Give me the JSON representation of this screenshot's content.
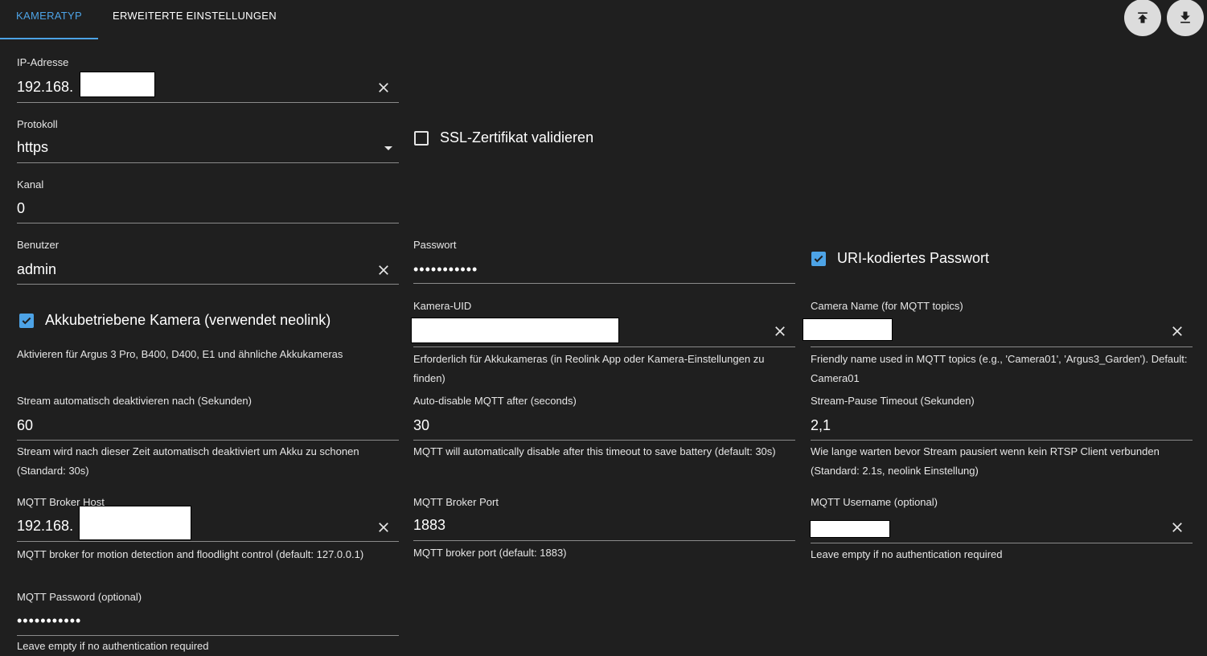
{
  "tabs": [
    {
      "label": "KAMERATYP",
      "active": true
    },
    {
      "label": "ERWEITERTE EINSTELLUNGEN",
      "active": false
    }
  ],
  "toolbar": {
    "upload_icon": "upload-icon",
    "download_icon": "download-icon"
  },
  "fields": {
    "ip": {
      "label": "IP-Adresse",
      "value": "192.168."
    },
    "protocol": {
      "label": "Protokoll",
      "value": "https"
    },
    "channel": {
      "label": "Kanal",
      "value": "0"
    },
    "user": {
      "label": "Benutzer",
      "value": "admin"
    },
    "password": {
      "label": "Passwort",
      "value": "•••••••••••"
    },
    "camera_uid": {
      "label": "Kamera-UID",
      "value": "",
      "helper": "Erforderlich für Akkukameras (in Reolink App oder Kamera-Einstellungen zu finden)"
    },
    "camera_name": {
      "label": "Camera Name (for MQTT topics)",
      "value": "",
      "helper": "Friendly name used in MQTT topics (e.g., 'Camera01', 'Argus3_Garden'). Default: Camera01"
    },
    "stream_disable": {
      "label": "Stream automatisch deaktivieren nach (Sekunden)",
      "value": "60",
      "helper": "Stream wird nach dieser Zeit automatisch deaktiviert um Akku zu schonen (Standard: 30s)"
    },
    "mqtt_disable": {
      "label": "Auto-disable MQTT after (seconds)",
      "value": "30",
      "helper": "MQTT will automatically disable after this timeout to save battery (default: 30s)"
    },
    "stream_pause": {
      "label": "Stream-Pause Timeout (Sekunden)",
      "value": "2,1",
      "helper": "Wie lange warten bevor Stream pausiert wenn kein RTSP Client verbunden (Standard: 2.1s, neolink Einstellung)"
    },
    "mqtt_host": {
      "label": "MQTT Broker Host",
      "value": "192.168.",
      "helper": "MQTT broker for motion detection and floodlight control (default: 127.0.0.1)"
    },
    "mqtt_port": {
      "label": "MQTT Broker Port",
      "value": "1883",
      "helper": "MQTT broker port (default: 1883)"
    },
    "mqtt_user": {
      "label": "MQTT Username (optional)",
      "value": "",
      "helper": "Leave empty if no authentication required"
    },
    "mqtt_password": {
      "label": "MQTT Password (optional)",
      "value": "•••••••••••",
      "helper": "Leave empty if no authentication required"
    }
  },
  "checkboxes": {
    "ssl": {
      "label": "SSL-Zertifikat validieren",
      "checked": false
    },
    "uri_pw": {
      "label": "URI-kodiertes Passwort",
      "checked": true
    },
    "battery": {
      "label": "Akkubetriebene Kamera (verwendet neolink)",
      "checked": true,
      "helper": "Aktivieren für Argus 3 Pro, B400, D400, E1 und ähnliche Akkukameras"
    }
  },
  "colors": {
    "accent": "#4da3e6",
    "background": "#1f1f1f"
  }
}
